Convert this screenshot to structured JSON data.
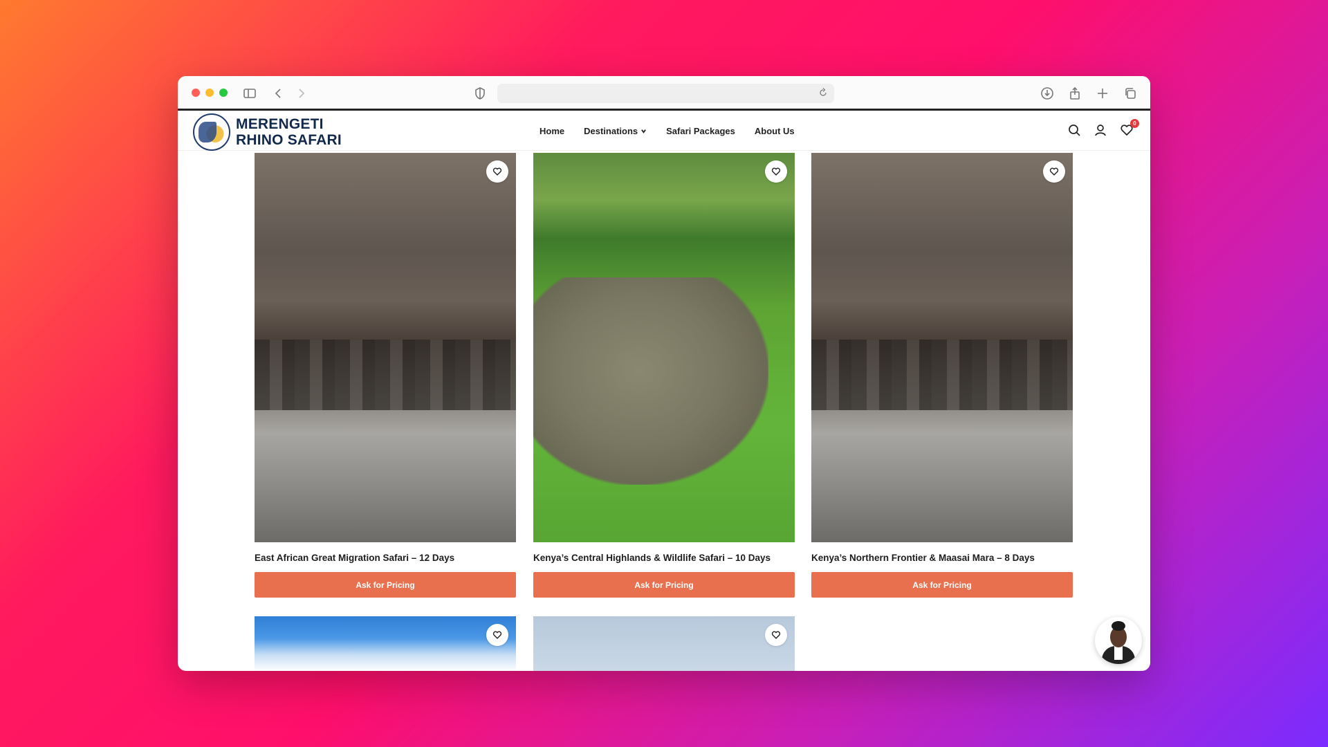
{
  "browser": {
    "url": "",
    "icons": [
      "sidebar-icon",
      "back-icon",
      "forward-icon",
      "shield-icon",
      "reload-icon",
      "download-icon",
      "share-icon",
      "new-tab-icon",
      "tabs-icon"
    ]
  },
  "site": {
    "logo_line1": "MERENGETI",
    "logo_line2": "RHINO SAFARI",
    "nav": [
      {
        "label": "Home"
      },
      {
        "label": "Destinations"
      },
      {
        "label": "Safari Packages"
      },
      {
        "label": "About Us"
      }
    ],
    "wishlist_count": "0"
  },
  "products": [
    {
      "title": "East African Great Migration Safari – 12 Days",
      "button": "Ask for Pricing"
    },
    {
      "title": "Kenya’s Central Highlands & Wildlife Safari – 10 Days",
      "button": "Ask for Pricing"
    },
    {
      "title": "Kenya’s Northern Frontier & Maasai Mara – 8 Days",
      "button": "Ask for Pricing"
    }
  ],
  "colors": {
    "accent": "#e8704e",
    "brand_navy": "#13294b",
    "badge": "#e23b3b"
  }
}
